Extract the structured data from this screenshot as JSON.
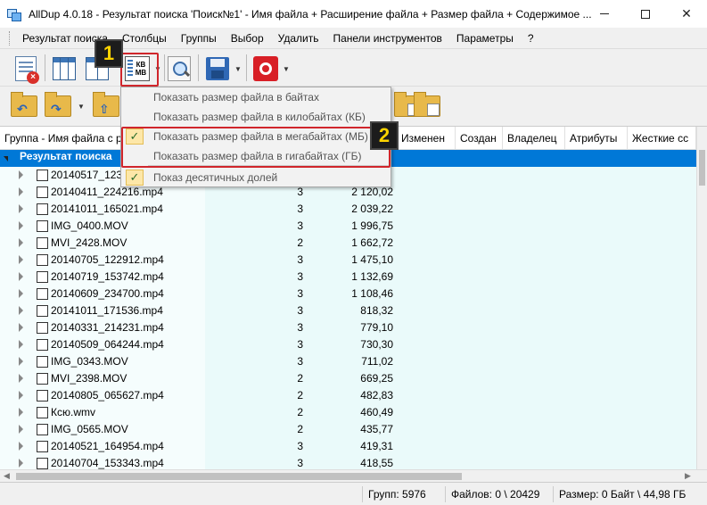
{
  "window": {
    "title": "AllDup 4.0.18 - Результат поиска 'Поиск№1' - Имя файла + Расширение файла + Размер файла + Содержимое ..."
  },
  "menu": [
    "Результат поиска",
    "Столбцы",
    "Группы",
    "Выбор",
    "Удалить",
    "Панели инструментов",
    "Параметры",
    "?"
  ],
  "toolbar": {
    "size_button_line1": "КВ",
    "size_button_line2": "МВ"
  },
  "annotations": {
    "badge1": "1",
    "badge2": "2",
    "highlight_color": "#d0262c",
    "badge_text_color": "#ffd400"
  },
  "dropdown": {
    "items": [
      {
        "label": "Показать размер файла в байтах",
        "checked": false
      },
      {
        "label": "Показать размер файла в килобайтах (КБ)",
        "checked": false
      },
      {
        "label": "Показать размер файла в мегабайтах (МБ)",
        "checked": true
      },
      {
        "label": "Показать размер файла в гигабайтах (ГБ)",
        "checked": false
      },
      {
        "label": "Показ десятичных долей",
        "checked": true
      }
    ],
    "check_glyph": "✓"
  },
  "grid": {
    "columns": [
      "Группа - Имя файла с р",
      "Изменен",
      "Создан",
      "Владелец",
      "Атрибуты",
      "Жесткие сс"
    ],
    "root_label": "Результат поиска",
    "selection_color": "#0078d7",
    "rows": [
      {
        "name": "20140517_123",
        "count": "",
        "size": ""
      },
      {
        "name": "20140411_224216.mp4",
        "count": "3",
        "size": "2 120,02"
      },
      {
        "name": "20141011_165021.mp4",
        "count": "3",
        "size": "2 039,22"
      },
      {
        "name": "IMG_0400.MOV",
        "count": "3",
        "size": "1 996,75"
      },
      {
        "name": "MVI_2428.MOV",
        "count": "2",
        "size": "1 662,72"
      },
      {
        "name": "20140705_122912.mp4",
        "count": "3",
        "size": "1 475,10"
      },
      {
        "name": "20140719_153742.mp4",
        "count": "3",
        "size": "1 132,69"
      },
      {
        "name": "20140609_234700.mp4",
        "count": "3",
        "size": "1 108,46"
      },
      {
        "name": "20141011_171536.mp4",
        "count": "3",
        "size": "818,32"
      },
      {
        "name": "20140331_214231.mp4",
        "count": "3",
        "size": "779,10"
      },
      {
        "name": "20140509_064244.mp4",
        "count": "3",
        "size": "730,30"
      },
      {
        "name": "IMG_0343.MOV",
        "count": "3",
        "size": "711,02"
      },
      {
        "name": "MVI_2398.MOV",
        "count": "2",
        "size": "669,25"
      },
      {
        "name": "20140805_065627.mp4",
        "count": "2",
        "size": "482,83"
      },
      {
        "name": "Ксю.wmv",
        "count": "2",
        "size": "460,49"
      },
      {
        "name": "IMG_0565.MOV",
        "count": "2",
        "size": "435,77"
      },
      {
        "name": "20140521_164954.mp4",
        "count": "3",
        "size": "419,31"
      },
      {
        "name": "20140704_153343.mp4",
        "count": "3",
        "size": "418,55"
      }
    ]
  },
  "status": {
    "groups": "Групп: 5976",
    "files": "Файлов: 0 \\ 20429",
    "size": "Размер: 0 Байт \\ 44,98 ГБ"
  }
}
